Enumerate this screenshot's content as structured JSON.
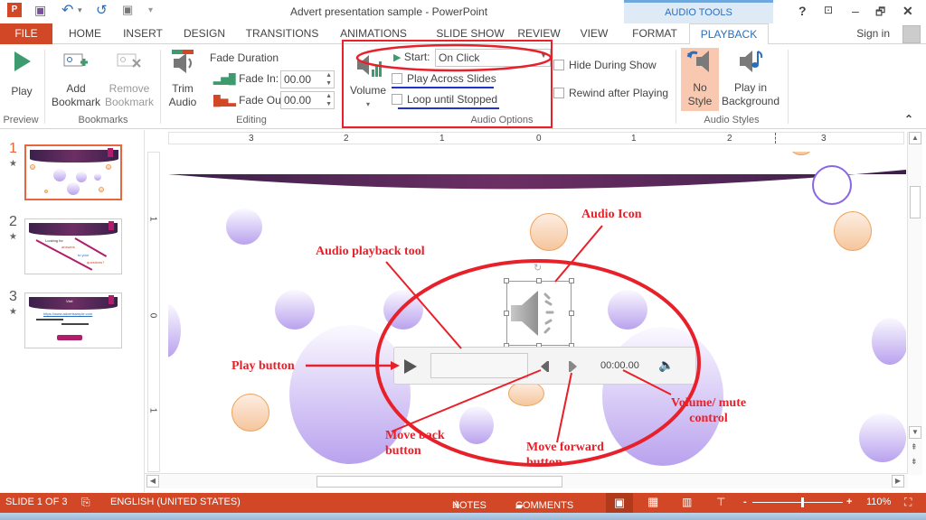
{
  "window": {
    "title": "Advert presentation sample - PowerPoint",
    "context_tab_group": "AUDIO TOOLS",
    "help": "?",
    "ribbon_display": "⬚",
    "minimize": "–",
    "restore": "❐",
    "close": "✕"
  },
  "qat": {
    "app_icon": "P",
    "save": "💾",
    "undo": "↶",
    "undo_dd": "▾",
    "redo": "↺",
    "start_from_beginning": "▣",
    "customize": "↕"
  },
  "tabs": [
    {
      "label": "FILE"
    },
    {
      "label": "HOME"
    },
    {
      "label": "INSERT"
    },
    {
      "label": "DESIGN"
    },
    {
      "label": "TRANSITIONS"
    },
    {
      "label": "ANIMATIONS"
    },
    {
      "label": "SLIDE SHOW"
    },
    {
      "label": "REVIEW"
    },
    {
      "label": "VIEW"
    },
    {
      "label": "FORMAT"
    },
    {
      "label": "PLAYBACK"
    }
  ],
  "account": {
    "sign_in": "Sign in"
  },
  "ribbon": {
    "preview": {
      "play": "Play",
      "group": "Preview"
    },
    "bookmarks": {
      "add_1": "Add",
      "add_2": "Bookmark",
      "remove_1": "Remove",
      "remove_2": "Bookmark",
      "group": "Bookmarks"
    },
    "editing": {
      "trim_1": "Trim",
      "trim_2": "Audio",
      "fade_duration": "Fade Duration",
      "fade_in_label": "Fade In:",
      "fade_in_value": "00.00",
      "fade_out_label": "Fade Out:",
      "fade_out_value": "00.00",
      "group": "Editing"
    },
    "audio_options": {
      "volume": "Volume",
      "start_label": "Start:",
      "start_value": "On Click",
      "play_across_slides": "Play Across Slides",
      "loop_until_stopped": "Loop until Stopped",
      "hide_during_show": "Hide During Show",
      "rewind_after_playing": "Rewind after Playing",
      "group": "Audio Options",
      "checked": {
        "play_across_slides": false,
        "loop_until_stopped": false,
        "hide_during_show": false,
        "rewind_after_playing": false
      }
    },
    "audio_styles": {
      "no_style_1": "No",
      "no_style_2": "Style",
      "play_bg_1": "Play in",
      "play_bg_2": "Background",
      "group": "Audio Styles"
    },
    "collapse": "⌃"
  },
  "thumbnails": [
    {
      "number": "1",
      "selected": true,
      "text": []
    },
    {
      "number": "2",
      "selected": false,
      "text": [
        "Looking for",
        "answers",
        "to your",
        "questions?"
      ]
    },
    {
      "number": "3",
      "selected": false,
      "text": [
        "Visit",
        "https://www.advertsample.com"
      ]
    }
  ],
  "ruler": {
    "horizontal": [
      "3",
      "2",
      "1",
      "0",
      "1",
      "2",
      "3"
    ],
    "vertical": [
      "1",
      "0",
      "1"
    ]
  },
  "player": {
    "time": "00:00.00",
    "progress": 0
  },
  "annotations": {
    "audio_icon": "Audio Icon",
    "playback_tool": "Audio playback tool",
    "play_button": "Play button",
    "move_back_1": "Move back",
    "move_back_2": "button",
    "move_forward_1": "Move forward",
    "move_forward_2": "button",
    "volume_1": "Volume/ mute",
    "volume_2": "control"
  },
  "status": {
    "slide": "SLIDE 1 OF 3",
    "language": "ENGLISH (UNITED STATES)",
    "notes": "NOTES",
    "comments": "COMMENTS",
    "zoom_minus": "-",
    "zoom_plus": "+",
    "zoom_level": "110%",
    "zoom_fraction": 0.55
  },
  "colors": {
    "accent": "#d24726",
    "playback_blue": "#2a6ebb",
    "annotation_red": "#e8202a",
    "annotation_blue": "#2233cc"
  }
}
